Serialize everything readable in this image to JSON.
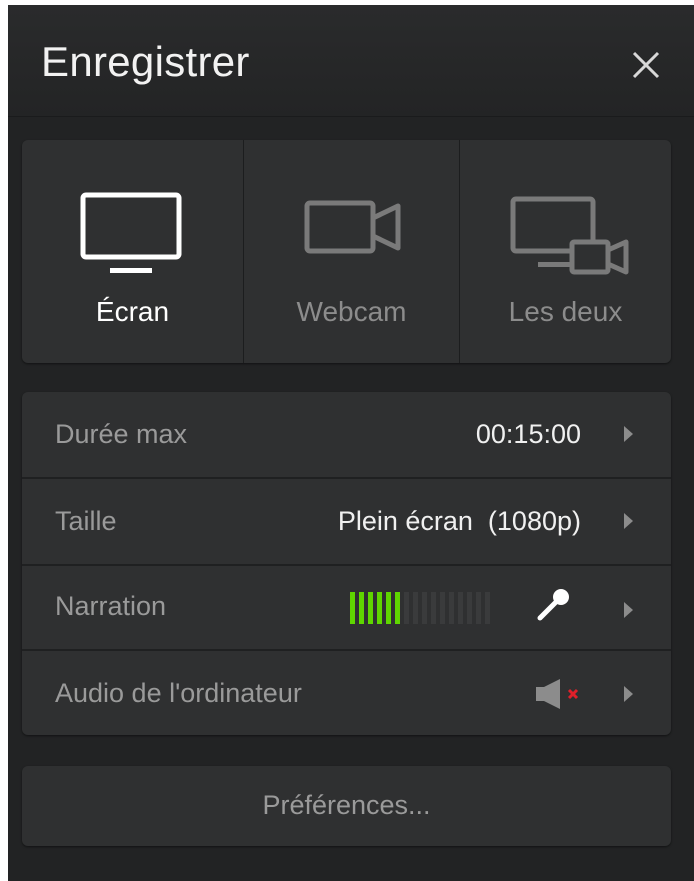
{
  "header": {
    "title": "Enregistrer"
  },
  "modes": [
    {
      "label": "Écran",
      "icon": "monitor-icon",
      "active": true
    },
    {
      "label": "Webcam",
      "icon": "webcam-icon",
      "active": false
    },
    {
      "label": "Les deux",
      "icon": "screen-and-webcam-icon",
      "active": false
    }
  ],
  "settings": {
    "duration": {
      "label": "Durée max",
      "value": "00:15:00"
    },
    "size": {
      "label": "Taille",
      "value": "Plein écran  (1080p)"
    },
    "narration": {
      "label": "Narration",
      "level_bars_lit": 6,
      "level_bars_total": 16,
      "icon": "microphone-icon"
    },
    "system_audio": {
      "label": "Audio de l'ordinateur",
      "icon": "speaker-muted-icon",
      "muted": true
    }
  },
  "preferences": {
    "label": "Préférences..."
  },
  "colors": {
    "background": "#222324",
    "card": "#2f3031",
    "meter_lit": "#5fd600",
    "meter_dim": "#3a3b3c",
    "mute_x": "#e0202a",
    "text_active": "#ffffff",
    "text_muted": "#9a9a9a"
  }
}
